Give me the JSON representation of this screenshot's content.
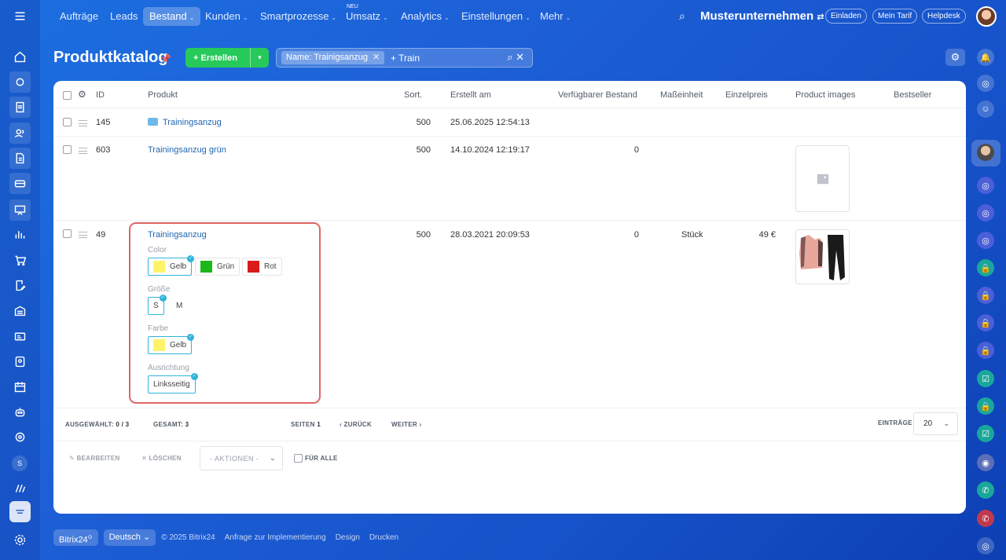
{
  "nav": {
    "items": [
      {
        "label": "Aufträge",
        "chevron": false
      },
      {
        "label": "Leads",
        "chevron": false
      },
      {
        "label": "Bestand",
        "chevron": true
      },
      {
        "label": "Kunden",
        "chevron": true
      },
      {
        "label": "Smartprozesse",
        "chevron": true
      },
      {
        "label": "Umsatz",
        "chevron": true
      },
      {
        "label": "Analytics",
        "chevron": true
      },
      {
        "label": "Einstellungen",
        "chevron": true
      },
      {
        "label": "Mehr",
        "chevron": true
      }
    ],
    "active_item": "Bestand",
    "new_badge": "NEU",
    "company": "Musterunternehmen",
    "buttons": {
      "invite": "Einladen",
      "tariff": "Mein Tarif",
      "helpdesk": "Helpdesk"
    }
  },
  "header": {
    "title": "Produktkatalog",
    "create_label": "Erstellen",
    "filter_chip": "Name: Trainigsanzug",
    "search_text": "+ Train"
  },
  "table": {
    "columns": {
      "id": "ID",
      "product": "Produkt",
      "sort": "Sort.",
      "created": "Erstellt am",
      "stock": "Verfügbarer Bestand",
      "unit": "Maßeinheit",
      "price": "Einzelpreis",
      "images": "Product images",
      "bestseller": "Bestseller"
    },
    "rows": [
      {
        "id": "145",
        "name": "Trainingsanzug",
        "sort": "500",
        "created": "25.06.2025 12:54:13",
        "stock": "",
        "unit": "",
        "price": ""
      },
      {
        "id": "603",
        "name": "Trainingsanzug grün",
        "sort": "500",
        "created": "14.10.2024 12:19:17",
        "stock": "0",
        "unit": "",
        "price": ""
      },
      {
        "id": "49",
        "name": "Trainingsanzug",
        "sort": "500",
        "created": "28.03.2021 20:09:53",
        "stock": "0",
        "unit": "Stück",
        "price": "49 €"
      }
    ],
    "properties": {
      "color_label": "Color",
      "color_options": [
        "Gelb",
        "Grün",
        "Rot"
      ],
      "size_label": "Größe",
      "size_options": [
        "S",
        "M"
      ],
      "farbe_label": "Farbe",
      "farbe_option": "Gelb",
      "align_label": "Ausrichtung",
      "align_option": "Linksseitig"
    }
  },
  "footer": {
    "selected_label": "AUSGEWÄHLT:",
    "selected_value": "0 / 3",
    "total_label": "GESAMT:",
    "total_value": "3",
    "pages_label": "SEITEN",
    "pages_value": "1",
    "back": "ZURÜCK",
    "next": "WEITER",
    "entries_label": "EINTRÄGE",
    "entries_value": "20",
    "edit": "BEARBEITEN",
    "delete": "LÖSCHEN",
    "actions": "- AKTIONEN -",
    "for_all": "FÜR ALLE"
  },
  "bottom": {
    "brand": "Bitrix24",
    "language": "Deutsch",
    "copyright": "© 2025 Bitrix24",
    "links": [
      "Anfrage zur Implementierung",
      "Design",
      "Drucken"
    ]
  },
  "colors": {
    "gelb": "#fff36b",
    "gruen": "#1bb71b",
    "rot": "#d81b1b",
    "create_green": "#26c95a",
    "highlight_red": "#e06565",
    "check_blue": "#32b3dc"
  }
}
